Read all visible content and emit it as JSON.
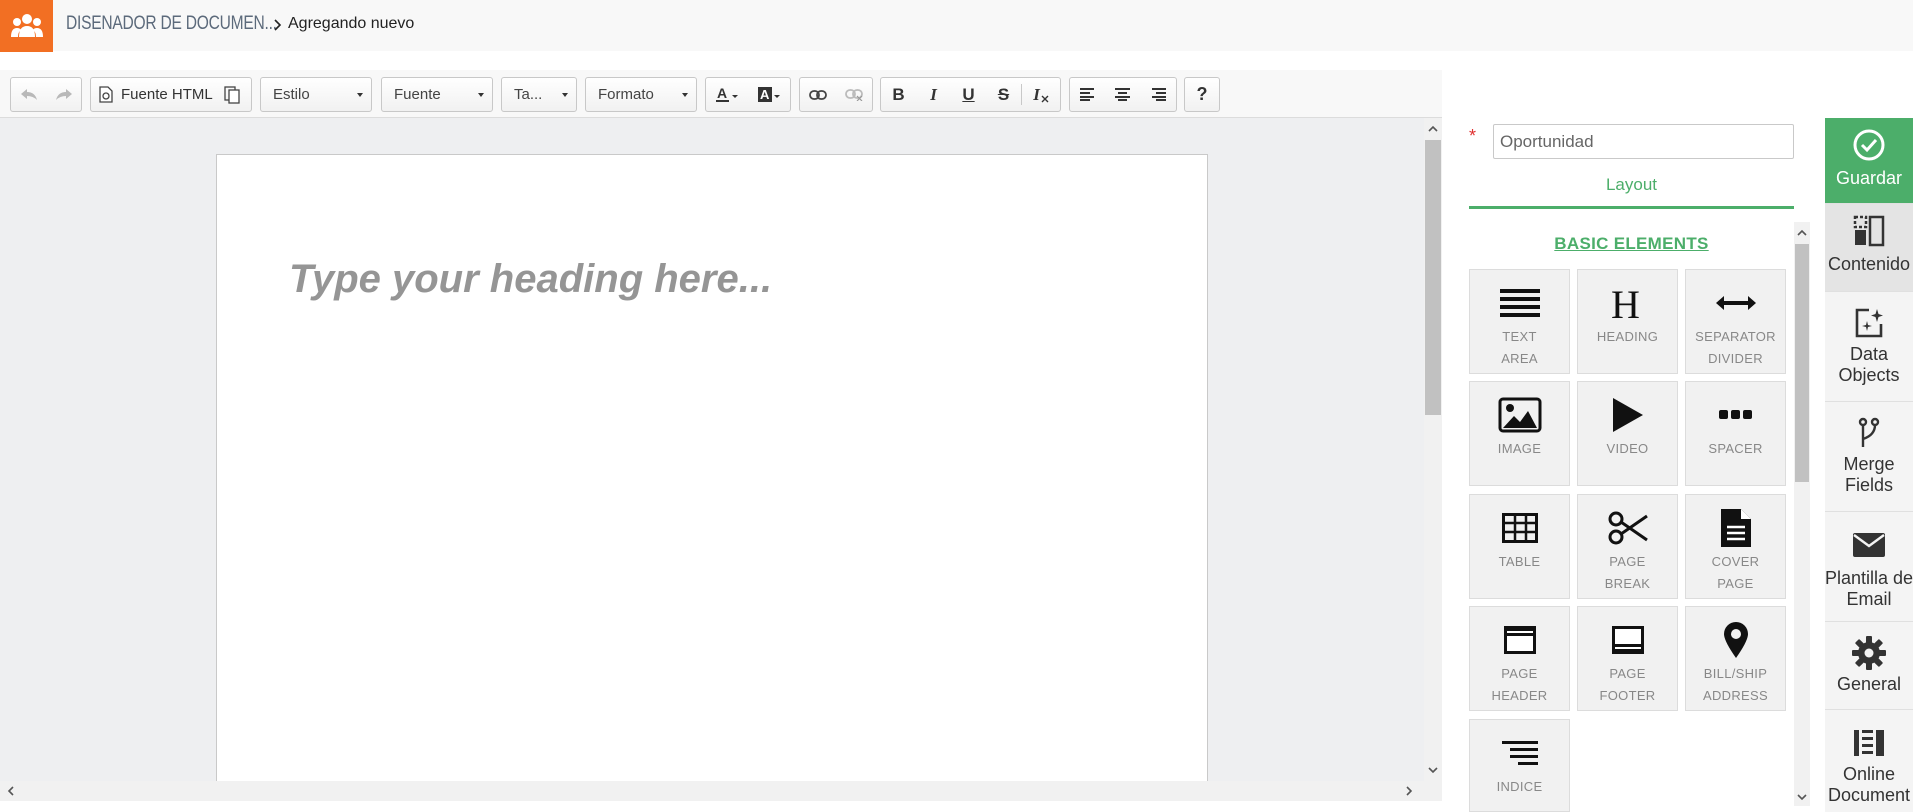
{
  "header": {
    "app_title": "DISENADOR DE DOCUMEN...",
    "breadcrumb_current": "Agregando nuevo",
    "logo_icon": "users-group-icon",
    "brand_color": "#f26f23"
  },
  "toolbar": {
    "undo_icon": "undo-icon",
    "redo_icon": "redo-icon",
    "source_label": "Fuente HTML",
    "style_label": "Estilo",
    "font_label": "Fuente",
    "size_label": "Ta...",
    "format_label": "Formato",
    "text_color_icon": "text-color-icon",
    "bg_color_icon": "background-color-icon",
    "link_icon": "link-icon",
    "unlink_icon": "unlink-icon",
    "bold_label": "B",
    "italic_label": "I",
    "underline_label": "U",
    "strike_label": "S",
    "clear_format_label": "I",
    "help_label": "?"
  },
  "editor": {
    "heading_placeholder": "Type your heading here..."
  },
  "panel": {
    "name_field_value": "Oportunidad",
    "required_mark": "*",
    "layout_tab": "Layout",
    "section_title": "BASIC ELEMENTS",
    "accent_color": "#4cae6a",
    "elements": [
      {
        "line1": "TEXT",
        "line2": "AREA",
        "icon": "text-area-icon"
      },
      {
        "line1": "HEADING",
        "line2": "",
        "icon": "heading-icon"
      },
      {
        "line1": "SEPARATOR",
        "line2": "DIVIDER",
        "icon": "separator-icon"
      },
      {
        "line1": "IMAGE",
        "line2": "",
        "icon": "image-icon"
      },
      {
        "line1": "VIDEO",
        "line2": "",
        "icon": "video-icon"
      },
      {
        "line1": "SPACER",
        "line2": "",
        "icon": "spacer-icon"
      },
      {
        "line1": "TABLE",
        "line2": "",
        "icon": "table-icon"
      },
      {
        "line1": "PAGE",
        "line2": "BREAK",
        "icon": "scissors-icon"
      },
      {
        "line1": "COVER",
        "line2": "PAGE",
        "icon": "cover-page-icon"
      },
      {
        "line1": "PAGE",
        "line2": "HEADER",
        "icon": "page-header-icon"
      },
      {
        "line1": "PAGE",
        "line2": "FOOTER",
        "icon": "page-footer-icon"
      },
      {
        "line1": "BILL/SHIP",
        "line2": "ADDRESS",
        "icon": "map-pin-icon"
      },
      {
        "line1": "INDICE",
        "line2": "",
        "icon": "index-icon"
      }
    ]
  },
  "sidebar": {
    "items": [
      {
        "line1": "Guardar",
        "line2": "",
        "icon": "check-circle-icon"
      },
      {
        "line1": "Contenido",
        "line2": "",
        "icon": "content-layout-icon"
      },
      {
        "line1": "Data",
        "line2": "Objects",
        "icon": "data-objects-icon"
      },
      {
        "line1": "Merge",
        "line2": "Fields",
        "icon": "merge-icon"
      },
      {
        "line1": "Plantilla de",
        "line2": "Email",
        "icon": "envelope-icon"
      },
      {
        "line1": "General",
        "line2": "",
        "icon": "gear-icon"
      },
      {
        "line1": "Online",
        "line2": "Document",
        "icon": "online-document-icon"
      }
    ]
  }
}
